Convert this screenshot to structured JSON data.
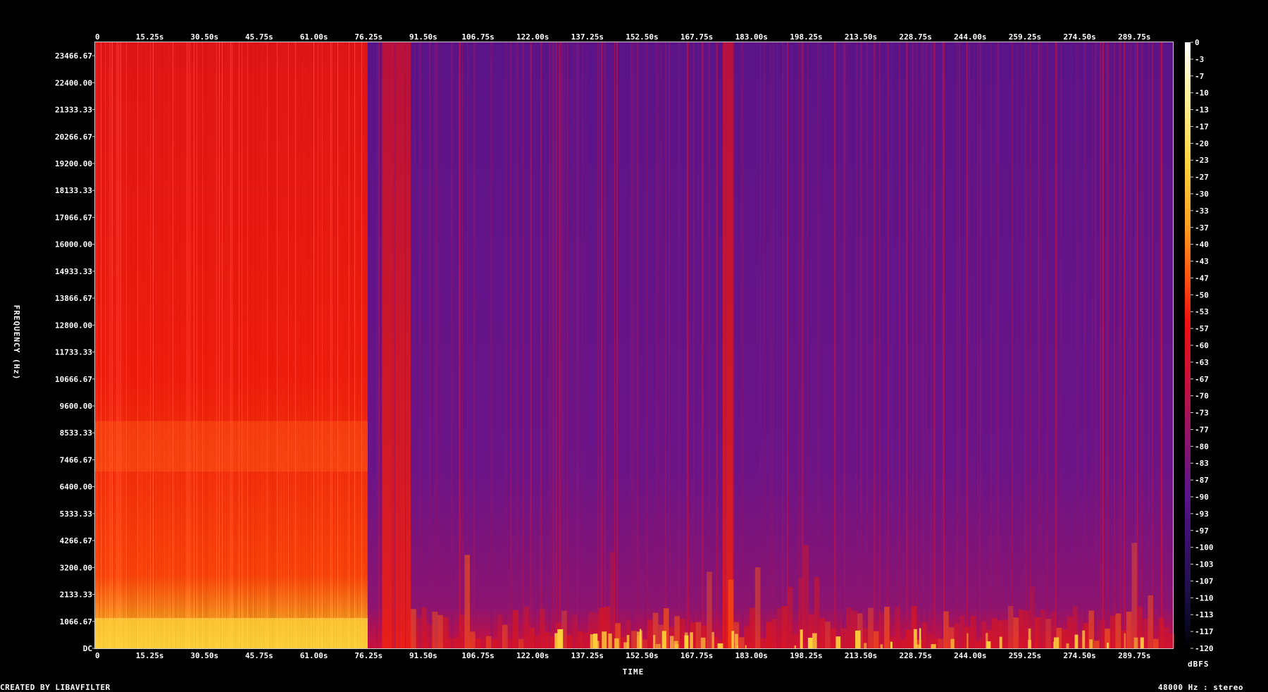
{
  "footer": {
    "created_by": "CREATED BY LIBAVFILTER",
    "stream_info": "48000 Hz : stereo"
  },
  "chart_data": {
    "type": "heatmap",
    "title": "",
    "xlabel": "TIME",
    "ylabel": "FREQUENCY (Hz)",
    "colorbar_label": "dBFS",
    "xlim": [
      0,
      305
    ],
    "ylim": [
      0,
      24000
    ],
    "zlim": [
      -120,
      0
    ],
    "x_tick_labels": [
      "0",
      "15.25s",
      "30.50s",
      "45.75s",
      "61.00s",
      "76.25s",
      "91.50s",
      "106.75s",
      "122.00s",
      "137.25s",
      "152.50s",
      "167.75s",
      "183.00s",
      "198.25s",
      "213.50s",
      "228.75s",
      "244.00s",
      "259.25s",
      "274.50s",
      "289.75s"
    ],
    "x_tick_values": [
      0,
      15.25,
      30.5,
      45.75,
      61,
      76.25,
      91.5,
      106.75,
      122,
      137.25,
      152.5,
      167.75,
      183,
      198.25,
      213.5,
      228.75,
      244,
      259.25,
      274.5,
      289.75
    ],
    "y_tick_labels": [
      "DC",
      "1066.67",
      "2133.33",
      "3200.00",
      "4266.67",
      "5333.33",
      "6400.00",
      "7466.67",
      "8533.33",
      "9600.00",
      "10666.67",
      "11733.33",
      "12800.00",
      "13866.67",
      "14933.33",
      "16000.00",
      "17066.67",
      "18133.33",
      "19200.00",
      "20266.67",
      "21333.33",
      "22400.00",
      "23466.67"
    ],
    "y_tick_values": [
      0,
      1066.67,
      2133.33,
      3200,
      4266.67,
      5333.33,
      6400,
      7466.67,
      8533.33,
      9600,
      10666.67,
      11733.33,
      12800,
      13866.67,
      14933.33,
      16000,
      17066.67,
      18133.33,
      19200,
      20266.67,
      21333.33,
      22400,
      23466.67
    ],
    "colorbar_tick_labels": [
      "0",
      "-3",
      "-7",
      "-10",
      "-13",
      "-17",
      "-20",
      "-23",
      "-27",
      "-30",
      "-33",
      "-37",
      "-40",
      "-43",
      "-47",
      "-50",
      "-53",
      "-57",
      "-60",
      "-63",
      "-67",
      "-70",
      "-73",
      "-77",
      "-80",
      "-83",
      "-87",
      "-90",
      "-93",
      "-97",
      "-100",
      "-103",
      "-107",
      "-110",
      "-113",
      "-117",
      "-120"
    ],
    "colormap": [
      "#ffffff",
      "#fff3a0",
      "#ffd23c",
      "#ffa020",
      "#ff5a10",
      "#f01010",
      "#c8103c",
      "#8c1470",
      "#5a148c",
      "#3a1070",
      "#20104c",
      "#0a0828",
      "#000000"
    ],
    "energy_regions": [
      {
        "t": [
          0,
          76
        ],
        "f": [
          0,
          24000
        ],
        "db": -45
      },
      {
        "t": [
          0,
          76
        ],
        "f": [
          0,
          1200
        ],
        "db": -15
      },
      {
        "t": [
          0,
          76
        ],
        "f": [
          7000,
          9000
        ],
        "db": -38
      },
      {
        "t": [
          80,
          88
        ],
        "f": [
          0,
          24000
        ],
        "db": -52
      },
      {
        "t": [
          175,
          178
        ],
        "f": [
          0,
          24000
        ],
        "db": -52
      },
      {
        "t": [
          120,
          305
        ],
        "f": [
          0,
          1500
        ],
        "db": -45
      },
      {
        "t": [
          88,
          305
        ],
        "f": [
          0,
          24000
        ],
        "db": -88
      }
    ]
  }
}
